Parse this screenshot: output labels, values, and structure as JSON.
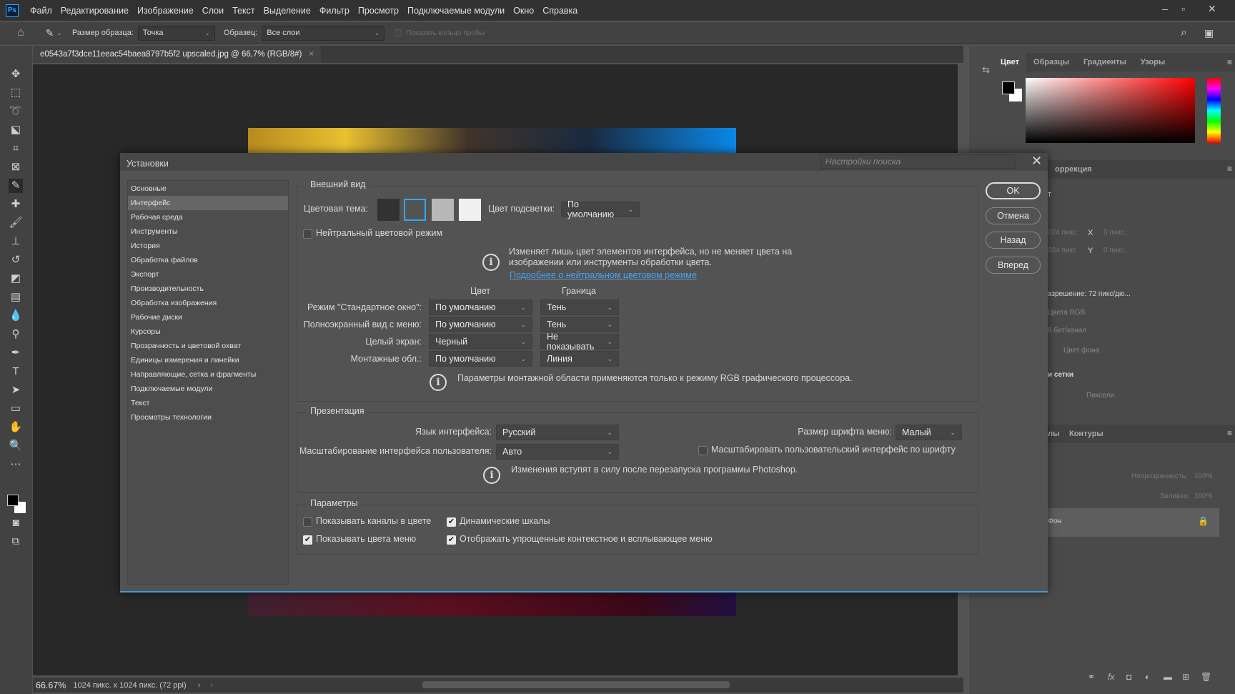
{
  "menubar": {
    "logo": "Ps",
    "items": [
      "Файл",
      "Редактирование",
      "Изображение",
      "Слои",
      "Текст",
      "Выделение",
      "Фильтр",
      "Просмотр",
      "Подключаемые модули",
      "Окно",
      "Справка"
    ]
  },
  "options": {
    "sample_size_label": "Размер образца:",
    "sample_size_value": "Точка",
    "sample_label": "Образец:",
    "sample_value": "Все слои",
    "show_ring_label": "Показать кольцо пробы"
  },
  "document": {
    "tab_title": "e0543a7f3dce11eeac54baea8797b5f2 upscaled.jpg @ 66,7% (RGB/8#)",
    "close": "×"
  },
  "status": {
    "zoom": "66.67%",
    "info": "1024 пикс. x 1024 пикс. (72 ppi)"
  },
  "color_panel": {
    "tabs": [
      "Цвет",
      "Образцы",
      "Градиенты",
      "Узоры"
    ],
    "active": "Цвет",
    "hue_color": "#ff0000"
  },
  "properties_panel": {
    "tab": "оррекция",
    "heading": "т",
    "w": "024 пикс",
    "h": "024 пикс",
    "x_label": "X",
    "x": "0 пикс.",
    "y_label": "Y",
    "y": "0 пикс.",
    "resolution": "азрешение: 72 пикс/дю...",
    "mode": "Цвета RGB",
    "depth": "8 бит/канал",
    "bg": "Цвет фона",
    "grid_heading": "и сетки",
    "units": "Пиксели"
  },
  "layers_panel": {
    "tabs": [
      "лы",
      "Контуры"
    ],
    "opacity_label": "Непрозрачность:",
    "opacity": "100%",
    "fill_label": "Заливка:",
    "fill": "100%",
    "layer_name": "Фон"
  },
  "dialog": {
    "title": "Установки",
    "search_placeholder": "Настройки поиска",
    "sidebar": [
      "Основные",
      "Интерфейс",
      "Рабочая среда",
      "Инструменты",
      "История",
      "Обработка файлов",
      "Экспорт",
      "Производительность",
      "Обработка изображения",
      "Рабочие диски",
      "Курсоры",
      "Прозрачность и цветовой охват",
      "Единицы измерения и линейки",
      "Направляющие, сетка и фрагменты",
      "Подключаемые модули",
      "Текст",
      "Просмотры технологии"
    ],
    "active_item": "Интерфейс",
    "buttons": {
      "ok": "OK",
      "cancel": "Отмена",
      "prev": "Назад",
      "next": "Вперед"
    },
    "appearance": {
      "legend": "Внешний вид",
      "theme_label": "Цветовая тема:",
      "themes": [
        "#323232",
        "#535353",
        "#b8b8b8",
        "#f0f0f0"
      ],
      "selected_theme": 2,
      "highlight_label": "Цвет подсветки:",
      "highlight_value": "По умолчанию",
      "neutral_label": "Нейтральный цветовой режим",
      "neutral_checked": false,
      "info_line1": "Изменяет лишь цвет элементов интерфейса, но не меняет цвета на",
      "info_line2": "изображении или инструменты обработки цвета.",
      "info_link": "Подробнее о нейтральном цветовом режиме",
      "col_color": "Цвет",
      "col_border": "Граница",
      "rows": [
        {
          "label": "Режим \"Стандартное окно\":",
          "color": "По умолчанию",
          "border": "Тень"
        },
        {
          "label": "Полноэкранный вид с меню:",
          "color": "По умолчанию",
          "border": "Тень"
        },
        {
          "label": "Целый экран:",
          "color": "Черный",
          "border": "Не показывать"
        },
        {
          "label": "Монтажные обл.:",
          "color": "По умолчанию",
          "border": "Линия"
        }
      ],
      "artboard_info": "Параметры монтажной области применяются только к режиму RGB графического процессора."
    },
    "presentation": {
      "legend": "Презентация",
      "lang_label": "Язык интерфейса:",
      "lang_value": "Русский",
      "scale_label": "Масштабирование интерфейса пользователя:",
      "scale_value": "Авто",
      "font_label": "Размер шрифта меню:",
      "font_value": "Малый",
      "scale_font_label": "Масштабировать пользовательский интерфейс по шрифту",
      "scale_font_checked": false,
      "info": "Изменения вступят в силу после перезапуска программы Photoshop."
    },
    "options": {
      "legend": "Параметры",
      "items": [
        {
          "label": "Показывать каналы в цвете",
          "checked": false
        },
        {
          "label": "Динамические шкалы",
          "checked": true
        },
        {
          "label": "Показывать цвета меню",
          "checked": true
        },
        {
          "label": "Отображать упрощенные контекстное и всплывающее меню",
          "checked": true
        }
      ]
    }
  }
}
